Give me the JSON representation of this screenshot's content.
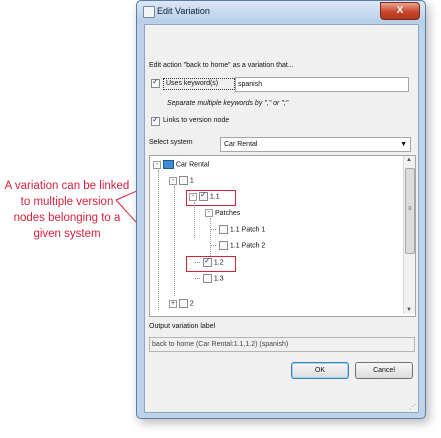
{
  "callout": {
    "text": "A variation can be linked to multiple version nodes belonging to a given system"
  },
  "window": {
    "title": "Edit Variation",
    "close_label": "X"
  },
  "form": {
    "description": "Edit action \"back to home\" as a variation that...",
    "uses_keywords_label": "Uses keyword(s)",
    "uses_keywords_checked": true,
    "keyword_value": "spanish",
    "hint": "Separate multiple keywords by \",\" or \";\"",
    "links_label": "Links to version node",
    "links_checked": true,
    "select_system_label": "Select system",
    "selected_system": "Car Rental"
  },
  "tree": {
    "root": "Car Rental",
    "nodes": {
      "v1": "1",
      "v11": "1.1",
      "patches": "Patches",
      "patch1": "1.1 Patch 1",
      "patch2": "1.1 Patch 2",
      "v12": "1.2",
      "v13": "1.3",
      "v2": "2"
    },
    "checked": {
      "v1": false,
      "v11": true,
      "patch1": false,
      "patch2": false,
      "v12": true,
      "v13": false,
      "v2": false
    }
  },
  "output": {
    "label": "Output variation label",
    "value": "back to home (Car Rental:1.1,1.2) (spanish)"
  },
  "buttons": {
    "ok": "OK",
    "cancel": "Cancel"
  },
  "icons": [
    "window-app-icon",
    "computer-icon",
    "expand-minus-icon",
    "scroll-up-icon",
    "scroll-down-icon",
    "resize-grip-icon"
  ],
  "colors": {
    "callout": "#d4213c",
    "title_bar": "#bcd3ea",
    "close_button": "#c7462a"
  }
}
